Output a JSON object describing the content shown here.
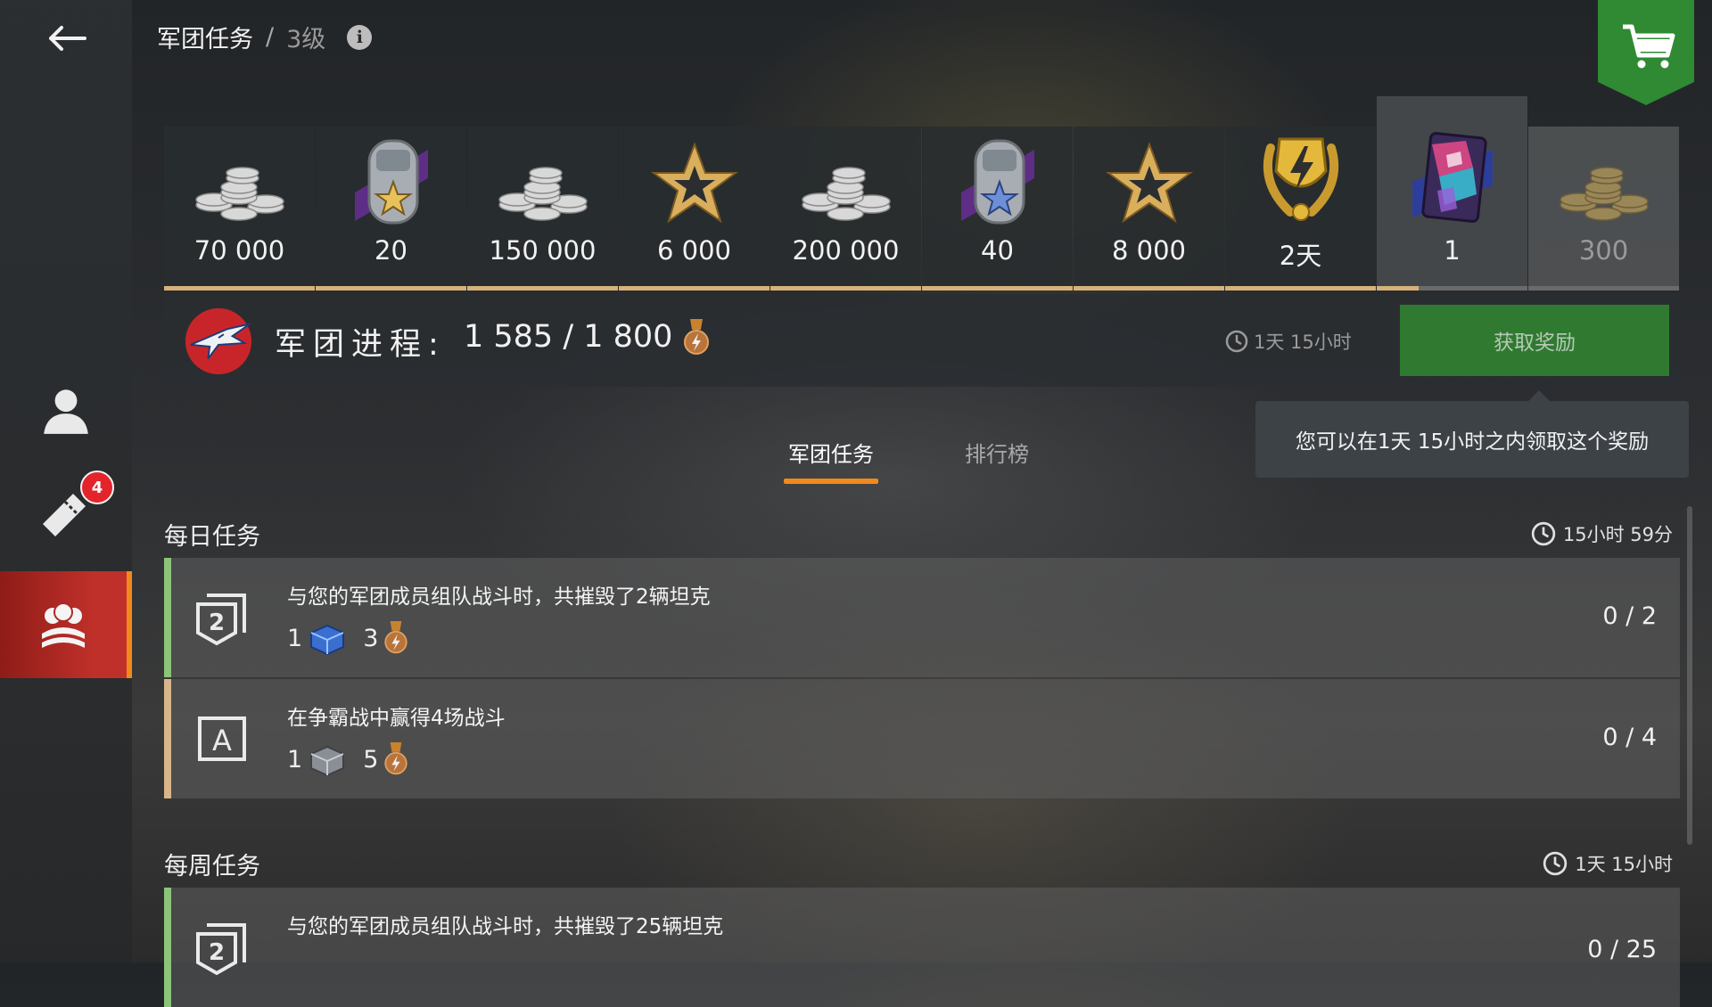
{
  "header": {
    "title": "军团任务",
    "separator": "/",
    "level": "3级"
  },
  "sidebar": {
    "notifications_badge": "4"
  },
  "rewards": [
    {
      "amount": "70 000",
      "type": "silver"
    },
    {
      "amount": "20",
      "type": "tank-tag-gold-star"
    },
    {
      "amount": "150 000",
      "type": "silver"
    },
    {
      "amount": "6 000",
      "type": "free-xp-star"
    },
    {
      "amount": "200 000",
      "type": "silver"
    },
    {
      "amount": "40",
      "type": "tank-tag-blue-star"
    },
    {
      "amount": "8 000",
      "type": "free-xp-star"
    },
    {
      "amount": "2天",
      "type": "premium-laurel"
    },
    {
      "amount": "1",
      "type": "crate"
    },
    {
      "amount": "300",
      "type": "gold"
    }
  ],
  "progress": {
    "label": "军团进程:",
    "value": "1 585 / 1 800",
    "timer": "1天 15小时",
    "claim_button": "获取奖励"
  },
  "tooltip": "您可以在1天 15小时之内领取这个奖励",
  "tabs": [
    {
      "label": "军团任务",
      "active": true
    },
    {
      "label": "排行榜",
      "active": false
    }
  ],
  "daily": {
    "title": "每日任务",
    "timer": "15小时 59分",
    "missions": [
      {
        "title": "与您的军团成员组队战斗时，共摧毁了2辆坦克",
        "reward_qty": "1",
        "medal_qty": "3",
        "progress": "0 / 2",
        "icon_text": "2"
      },
      {
        "title": "在争霸战中赢得4场战斗",
        "reward_qty": "1",
        "medal_qty": "5",
        "progress": "0 / 4",
        "icon_text": "A"
      }
    ]
  },
  "weekly": {
    "title": "每周任务",
    "timer": "1天 15小时",
    "missions": [
      {
        "title": "与您的军团成员组队战斗时，共摧毁了25辆坦克",
        "progress": "0 / 25",
        "icon_text": "2"
      }
    ]
  },
  "colors": {
    "accent": "#f08a1c",
    "claim": "#2f7a30",
    "active_nav": "#c0302a",
    "badge": "#e3242b"
  }
}
